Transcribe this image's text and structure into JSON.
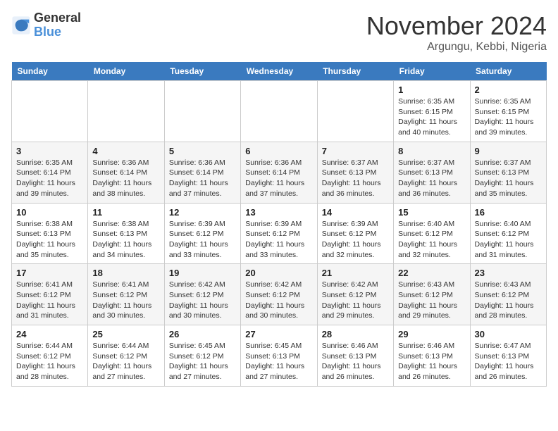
{
  "logo": {
    "line1": "General",
    "line2": "Blue"
  },
  "title": "November 2024",
  "location": "Argungu, Kebbi, Nigeria",
  "days_of_week": [
    "Sunday",
    "Monday",
    "Tuesday",
    "Wednesday",
    "Thursday",
    "Friday",
    "Saturday"
  ],
  "weeks": [
    [
      {
        "num": "",
        "info": ""
      },
      {
        "num": "",
        "info": ""
      },
      {
        "num": "",
        "info": ""
      },
      {
        "num": "",
        "info": ""
      },
      {
        "num": "",
        "info": ""
      },
      {
        "num": "1",
        "info": "Sunrise: 6:35 AM\nSunset: 6:15 PM\nDaylight: 11 hours and 40 minutes."
      },
      {
        "num": "2",
        "info": "Sunrise: 6:35 AM\nSunset: 6:15 PM\nDaylight: 11 hours and 39 minutes."
      }
    ],
    [
      {
        "num": "3",
        "info": "Sunrise: 6:35 AM\nSunset: 6:14 PM\nDaylight: 11 hours and 39 minutes."
      },
      {
        "num": "4",
        "info": "Sunrise: 6:36 AM\nSunset: 6:14 PM\nDaylight: 11 hours and 38 minutes."
      },
      {
        "num": "5",
        "info": "Sunrise: 6:36 AM\nSunset: 6:14 PM\nDaylight: 11 hours and 37 minutes."
      },
      {
        "num": "6",
        "info": "Sunrise: 6:36 AM\nSunset: 6:14 PM\nDaylight: 11 hours and 37 minutes."
      },
      {
        "num": "7",
        "info": "Sunrise: 6:37 AM\nSunset: 6:13 PM\nDaylight: 11 hours and 36 minutes."
      },
      {
        "num": "8",
        "info": "Sunrise: 6:37 AM\nSunset: 6:13 PM\nDaylight: 11 hours and 36 minutes."
      },
      {
        "num": "9",
        "info": "Sunrise: 6:37 AM\nSunset: 6:13 PM\nDaylight: 11 hours and 35 minutes."
      }
    ],
    [
      {
        "num": "10",
        "info": "Sunrise: 6:38 AM\nSunset: 6:13 PM\nDaylight: 11 hours and 35 minutes."
      },
      {
        "num": "11",
        "info": "Sunrise: 6:38 AM\nSunset: 6:13 PM\nDaylight: 11 hours and 34 minutes."
      },
      {
        "num": "12",
        "info": "Sunrise: 6:39 AM\nSunset: 6:12 PM\nDaylight: 11 hours and 33 minutes."
      },
      {
        "num": "13",
        "info": "Sunrise: 6:39 AM\nSunset: 6:12 PM\nDaylight: 11 hours and 33 minutes."
      },
      {
        "num": "14",
        "info": "Sunrise: 6:39 AM\nSunset: 6:12 PM\nDaylight: 11 hours and 32 minutes."
      },
      {
        "num": "15",
        "info": "Sunrise: 6:40 AM\nSunset: 6:12 PM\nDaylight: 11 hours and 32 minutes."
      },
      {
        "num": "16",
        "info": "Sunrise: 6:40 AM\nSunset: 6:12 PM\nDaylight: 11 hours and 31 minutes."
      }
    ],
    [
      {
        "num": "17",
        "info": "Sunrise: 6:41 AM\nSunset: 6:12 PM\nDaylight: 11 hours and 31 minutes."
      },
      {
        "num": "18",
        "info": "Sunrise: 6:41 AM\nSunset: 6:12 PM\nDaylight: 11 hours and 30 minutes."
      },
      {
        "num": "19",
        "info": "Sunrise: 6:42 AM\nSunset: 6:12 PM\nDaylight: 11 hours and 30 minutes."
      },
      {
        "num": "20",
        "info": "Sunrise: 6:42 AM\nSunset: 6:12 PM\nDaylight: 11 hours and 30 minutes."
      },
      {
        "num": "21",
        "info": "Sunrise: 6:42 AM\nSunset: 6:12 PM\nDaylight: 11 hours and 29 minutes."
      },
      {
        "num": "22",
        "info": "Sunrise: 6:43 AM\nSunset: 6:12 PM\nDaylight: 11 hours and 29 minutes."
      },
      {
        "num": "23",
        "info": "Sunrise: 6:43 AM\nSunset: 6:12 PM\nDaylight: 11 hours and 28 minutes."
      }
    ],
    [
      {
        "num": "24",
        "info": "Sunrise: 6:44 AM\nSunset: 6:12 PM\nDaylight: 11 hours and 28 minutes."
      },
      {
        "num": "25",
        "info": "Sunrise: 6:44 AM\nSunset: 6:12 PM\nDaylight: 11 hours and 27 minutes."
      },
      {
        "num": "26",
        "info": "Sunrise: 6:45 AM\nSunset: 6:12 PM\nDaylight: 11 hours and 27 minutes."
      },
      {
        "num": "27",
        "info": "Sunrise: 6:45 AM\nSunset: 6:13 PM\nDaylight: 11 hours and 27 minutes."
      },
      {
        "num": "28",
        "info": "Sunrise: 6:46 AM\nSunset: 6:13 PM\nDaylight: 11 hours and 26 minutes."
      },
      {
        "num": "29",
        "info": "Sunrise: 6:46 AM\nSunset: 6:13 PM\nDaylight: 11 hours and 26 minutes."
      },
      {
        "num": "30",
        "info": "Sunrise: 6:47 AM\nSunset: 6:13 PM\nDaylight: 11 hours and 26 minutes."
      }
    ]
  ]
}
